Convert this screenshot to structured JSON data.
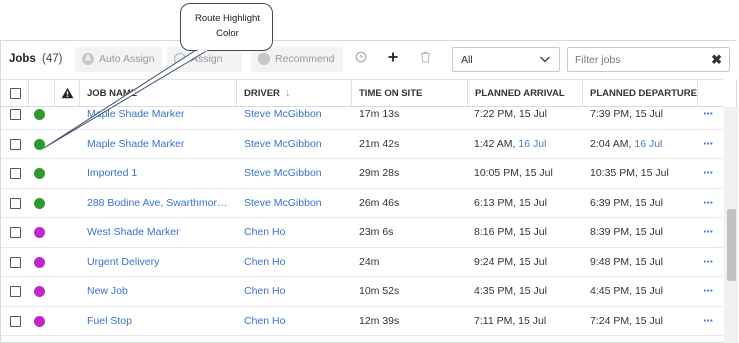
{
  "toolbar": {
    "title": "Jobs",
    "count": "(47)",
    "auto_assign": "Auto Assign",
    "assign": "Assign",
    "recommend": "Recommend",
    "select_value": "All",
    "filter_placeholder": "Filter jobs"
  },
  "columns": {
    "job_name": "JOB NAME",
    "driver": "DRIVER",
    "time_on_site": "TIME ON SITE",
    "planned_arrival": "PLANNED ARRIVAL",
    "planned_departure": "PLANNED DEPARTURE"
  },
  "rows": [
    {
      "route_color": "#2e9a2e",
      "job": "Maple Shade Marker",
      "driver": "Steve McGibbon",
      "time": "17m 13s",
      "arr_time": "7:22 PM, ",
      "arr_date": "15 Jul",
      "dep_time": "7:39 PM, ",
      "dep_date": "15 Jul",
      "date_highlight": false
    },
    {
      "route_color": "#2e9a2e",
      "job": "Maple Shade Marker",
      "driver": "Steve McGibbon",
      "time": "21m 42s",
      "arr_time": "1:42 AM, ",
      "arr_date": "16 Jul",
      "dep_time": "2:04 AM, ",
      "dep_date": "16 Jul",
      "date_highlight": true
    },
    {
      "route_color": "#2e9a2e",
      "job": "Imported 1",
      "driver": "Steve McGibbon",
      "time": "29m 28s",
      "arr_time": "10:05 PM, ",
      "arr_date": "15 Jul",
      "dep_time": "10:35 PM, ",
      "dep_date": "15 Jul",
      "date_highlight": false
    },
    {
      "route_color": "#2e9a2e",
      "job": "288 Bodine Ave, Swarthmore, …",
      "driver": "Steve McGibbon",
      "time": "26m 46s",
      "arr_time": "6:13 PM, ",
      "arr_date": "15 Jul",
      "dep_time": "6:39 PM, ",
      "dep_date": "15 Jul",
      "date_highlight": false
    },
    {
      "route_color": "#c026c8",
      "job": "West Shade Marker",
      "driver": "Chen Ho",
      "time": "23m 6s",
      "arr_time": "8:16 PM, ",
      "arr_date": "15 Jul",
      "dep_time": "8:39 PM, ",
      "dep_date": "15 Jul",
      "date_highlight": false
    },
    {
      "route_color": "#c026c8",
      "job": "Urgent Delivery",
      "driver": "Chen Ho",
      "time": "24m",
      "arr_time": "9:24 PM, ",
      "arr_date": "15 Jul",
      "dep_time": "9:48 PM, ",
      "dep_date": "15 Jul",
      "date_highlight": false
    },
    {
      "route_color": "#c026c8",
      "job": "New Job",
      "driver": "Chen Ho",
      "time": "10m 52s",
      "arr_time": "4:35 PM, ",
      "arr_date": "15 Jul",
      "dep_time": "4:45 PM, ",
      "dep_date": "15 Jul",
      "date_highlight": false
    },
    {
      "route_color": "#c026c8",
      "job": "Fuel Stop",
      "driver": "Chen Ho",
      "time": "12m 39s",
      "arr_time": "7:11 PM, ",
      "arr_date": "15 Jul",
      "dep_time": "7:24 PM, ",
      "dep_date": "15 Jul",
      "date_highlight": false
    }
  ],
  "callout": {
    "line1": "Route Highlight",
    "line2": "Color"
  },
  "colors": {
    "link": "#3a73c9",
    "green_route": "#2e9a2e",
    "purple_route": "#c026c8"
  }
}
